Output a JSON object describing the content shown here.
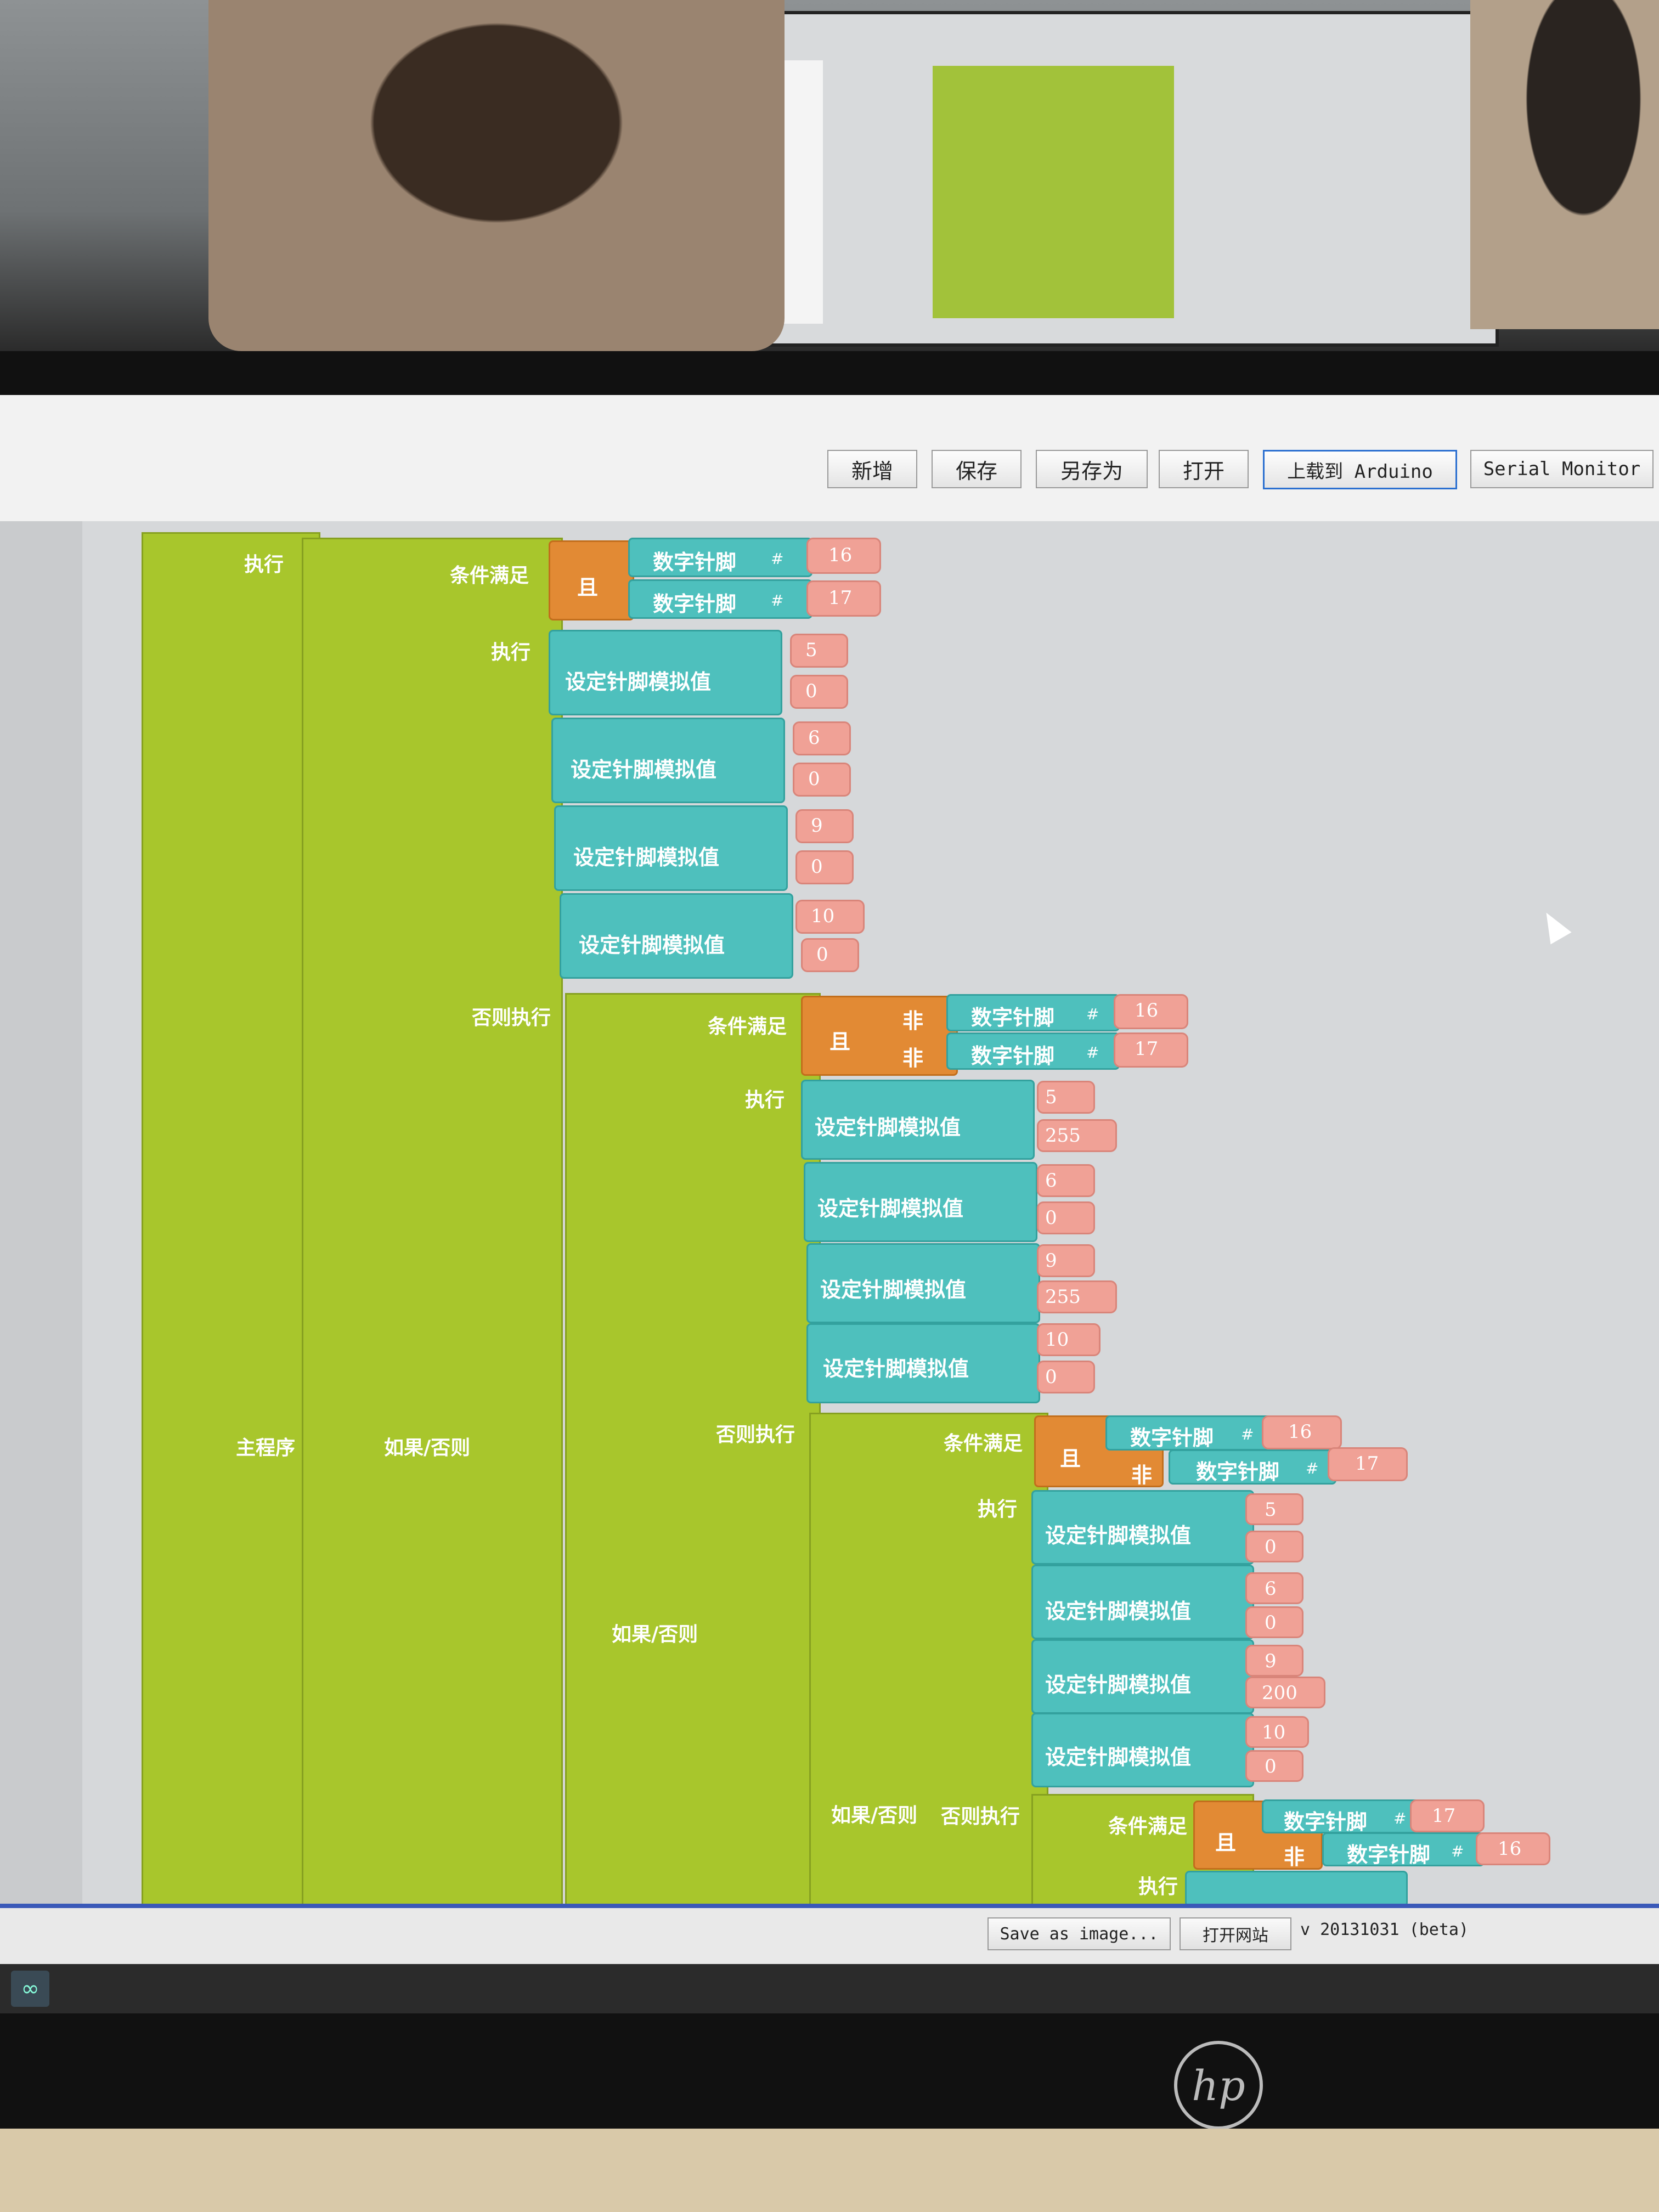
{
  "toolbar": {
    "new": "新增",
    "save": "保存",
    "save_as": "另存为",
    "open": "打开",
    "upload": "上载到 Arduino",
    "serial_monitor": "Serial Monitor"
  },
  "labels": {
    "main": "主程序",
    "execute": "执行",
    "condition": "条件满足",
    "else_execute": "否则执行",
    "if_else": "如果/否则",
    "and": "且",
    "not": "非",
    "digital_pin": "数字针脚",
    "set_analog": "设定针脚模拟值",
    "hash": "#"
  },
  "blocks": {
    "if1": {
      "pins": [
        "16",
        "17"
      ],
      "sets": [
        [
          "5",
          "0"
        ],
        [
          "6",
          "0"
        ],
        [
          "9",
          "0"
        ],
        [
          "10",
          "0"
        ]
      ]
    },
    "if2": {
      "pins": [
        "16",
        "17"
      ],
      "sets": [
        [
          "5",
          "255"
        ],
        [
          "6",
          "0"
        ],
        [
          "9",
          "255"
        ],
        [
          "10",
          "0"
        ]
      ]
    },
    "if3": {
      "pins": [
        "16",
        "17"
      ],
      "sets": [
        [
          "5",
          "0"
        ],
        [
          "6",
          "0"
        ],
        [
          "9",
          "200"
        ],
        [
          "10",
          "0"
        ]
      ]
    },
    "if4": {
      "pins": [
        "17",
        "16"
      ]
    }
  },
  "status": {
    "save_image": "Save as image...",
    "open_site": "打开网站",
    "version": "v 20131031 (beta)"
  },
  "brand": {
    "logo": "hp"
  }
}
